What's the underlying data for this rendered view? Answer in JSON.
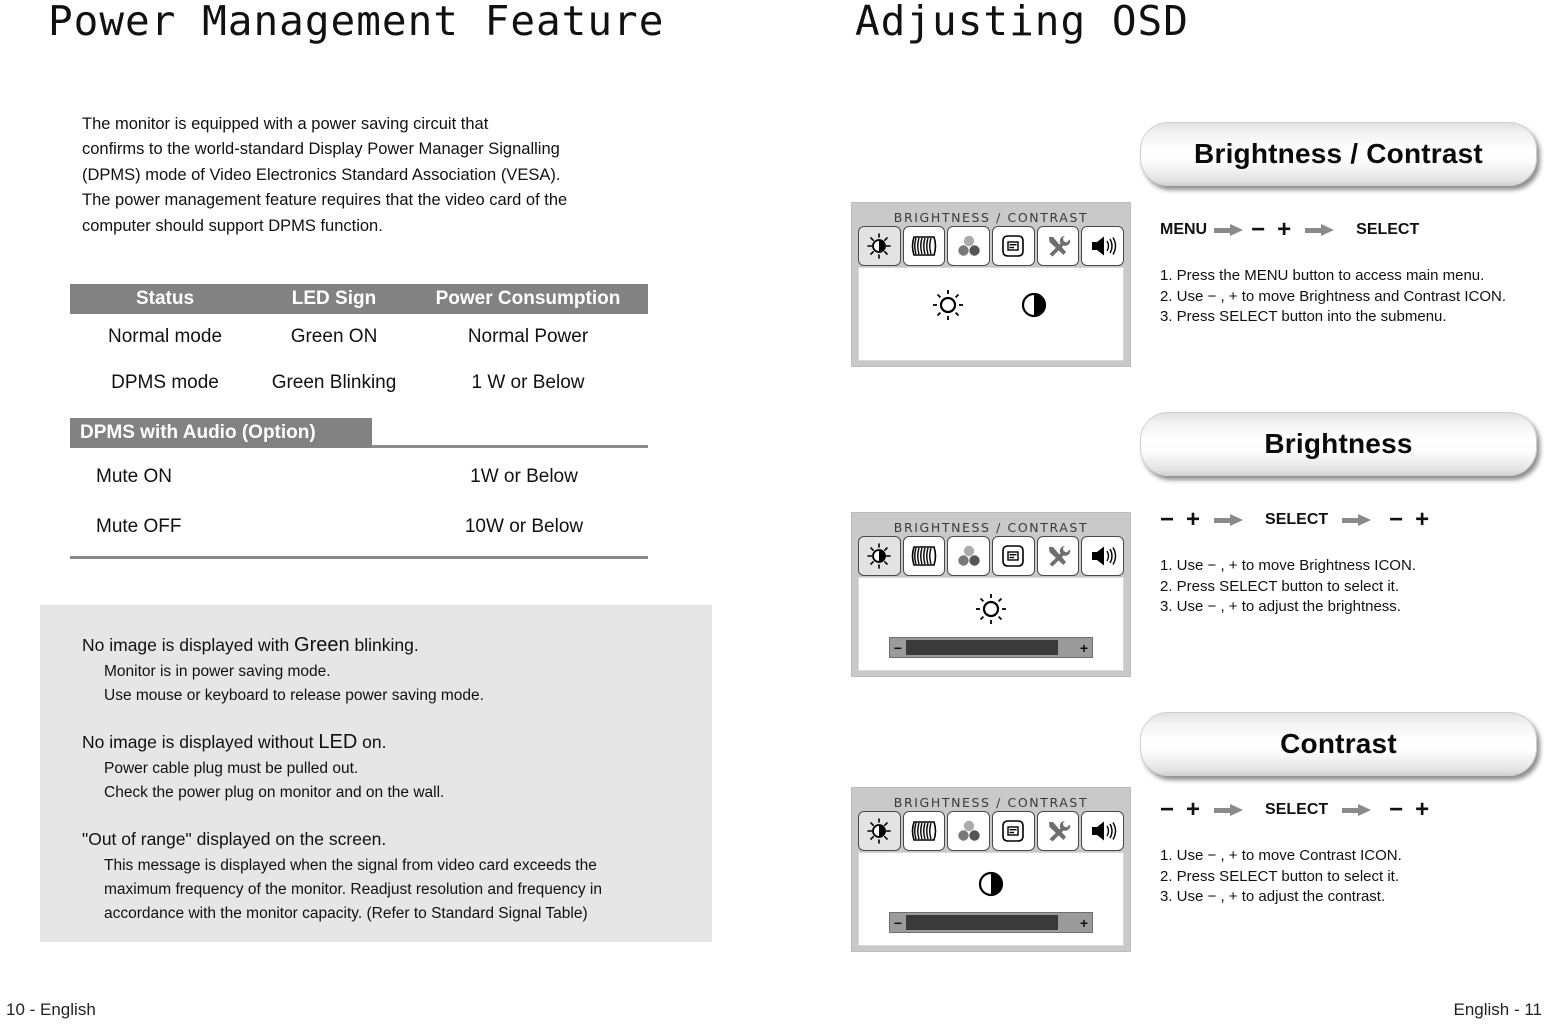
{
  "left_page": {
    "title": "Power Management Feature",
    "intro_lines": [
      "The monitor is equipped with a power saving circuit that",
      "confirms to the world-standard Display Power Manager Signalling",
      "(DPMS) mode of Video Electronics Standard Association (VESA).",
      "The power management feature requires that the video card of the",
      "computer should support DPMS function."
    ],
    "table": {
      "headers": [
        "Status",
        "LED Sign",
        "Power Consumption"
      ],
      "rows": [
        [
          "Normal mode",
          "Green ON",
          "Normal Power"
        ],
        [
          "DPMS mode",
          "Green Blinking",
          "1 W or Below"
        ]
      ],
      "sub_header": "DPMS with Audio (Option)",
      "sub_rows": [
        [
          "Mute ON",
          "1W or Below"
        ],
        [
          "Mute OFF",
          "10W or Below"
        ]
      ]
    },
    "info_box": {
      "blocks": [
        {
          "head_pre": "No image is displayed with ",
          "head_emph": "Green",
          "head_post": " blinking.",
          "lines": [
            "Monitor is in power saving mode.",
            "Use mouse or keyboard to release power saving mode."
          ]
        },
        {
          "head_pre": "No image is displayed without ",
          "head_emph": "LED",
          "head_post": " on.",
          "lines": [
            "Power cable plug must be pulled out.",
            "Check the power plug on monitor and on the wall."
          ]
        },
        {
          "head_pre": "\"Out of range\" displayed on the screen.",
          "head_emph": "",
          "head_post": "",
          "lines": [
            "This message is displayed when the signal from video card exceeds the",
            "maximum frequency of the monitor. Readjust resolution and frequency in",
            "accordance with the monitor capacity. (Refer to Standard Signal Table)"
          ]
        }
      ]
    },
    "footer": "10 - English"
  },
  "right_page": {
    "title": "Adjusting OSD",
    "footer": "English - 11",
    "osd_menu_title": "BRIGHTNESS / CONTRAST",
    "osd_icon_names": [
      "brightness-contrast-icon",
      "moire-icon",
      "color-icon",
      "osd-menu-icon",
      "tools-icon",
      "audio-icon"
    ],
    "sections": [
      {
        "header": "Brightness / Contrast",
        "screen_symbols": [
          "sun-icon",
          "contrast-icon"
        ],
        "has_slider": false,
        "button_sequence": [
          "MENU",
          "arrow",
          "−",
          "+",
          "arrow",
          "SELECT"
        ],
        "steps": [
          "1. Press the MENU button to access main menu.",
          "2. Use − , + to move Brightness and Contrast ICON.",
          "3. Press SELECT button into the submenu."
        ]
      },
      {
        "header": "Brightness",
        "screen_symbols": [
          "sun-icon"
        ],
        "has_slider": true,
        "slider_value": 75,
        "slider_minus": "−",
        "slider_plus": "+",
        "button_sequence": [
          "−",
          "+",
          "arrow",
          "SELECT",
          "arrow",
          "−",
          "+"
        ],
        "steps": [
          "1. Use − , + to move Brightness ICON.",
          "2. Press SELECT button to select it.",
          "3. Use − , + to adjust the brightness."
        ]
      },
      {
        "header": "Contrast",
        "screen_symbols": [
          "contrast-icon"
        ],
        "has_slider": true,
        "slider_value": 75,
        "slider_minus": "−",
        "slider_plus": "+",
        "button_sequence": [
          "−",
          "+",
          "arrow",
          "SELECT",
          "arrow",
          "−",
          "+"
        ],
        "steps": [
          "1. Use − , + to move Contrast ICON.",
          "2. Press SELECT button to select it.",
          "3. Use − , + to adjust the contrast."
        ]
      }
    ]
  },
  "colors": {
    "table_header_bg": "#828282",
    "info_box_bg": "#e6e6e6",
    "osd_screen_bg": "#c9c9c9",
    "arrow_gray": "#8a8a8a",
    "slider_fill": "#3a3a3a"
  }
}
